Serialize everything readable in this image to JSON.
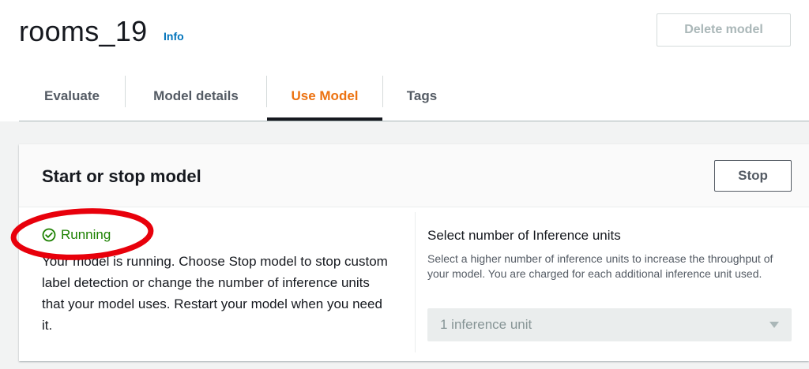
{
  "header": {
    "title": "rooms_19",
    "info_label": "Info",
    "delete_label": "Delete model"
  },
  "tabs": [
    {
      "label": "Evaluate"
    },
    {
      "label": "Model details"
    },
    {
      "label": "Use Model"
    },
    {
      "label": "Tags"
    }
  ],
  "active_tab": "Use Model",
  "panel": {
    "title": "Start or stop model",
    "stop_label": "Stop",
    "status_label": "Running",
    "description": "Your model is running. Choose Stop model to stop custom label detection or change the number of inference units that your model uses. Restart your model when you need it.",
    "units": {
      "label": "Select number of Inference units",
      "hint": "Select a higher number of inference units to increase the throughput of your model. You are charged for each additional inference unit used.",
      "selected_value": "1 inference unit"
    }
  },
  "colors": {
    "accent": "#ec7211",
    "link": "#0073bb",
    "status_success": "#1d8102",
    "annotation": "#e8000b"
  }
}
